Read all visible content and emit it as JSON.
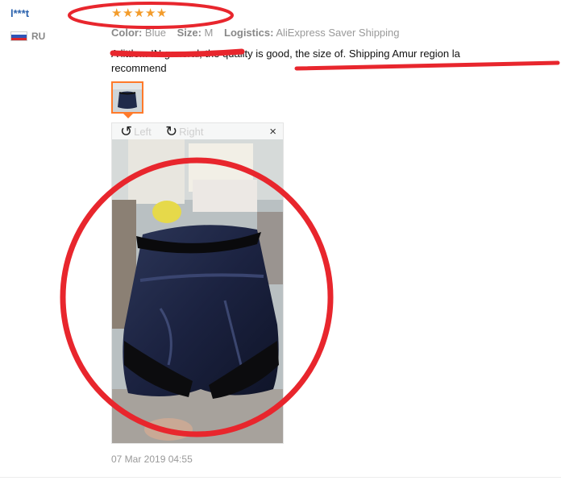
{
  "review": {
    "username": "l***t",
    "country": "RU",
    "rating": 5,
    "stars": "★★★★★",
    "attributes": [
      {
        "label": "Color:",
        "value": "Blue"
      },
      {
        "label": "Size:",
        "value": "M"
      },
      {
        "label": "Logistics:",
        "value": "AliExpress Saver Shipping"
      }
    ],
    "text_line1": "A little... IN general, the quality is good, the size of. Shipping Amur region la",
    "text_line2": "recommend",
    "viewer": {
      "rotate_left_label": "Left",
      "rotate_right_label": "Right",
      "close_symbol": "×"
    },
    "date": "07 Mar 2019 04:55"
  },
  "colors": {
    "username": "#2b62ad",
    "star": "#f39c2b",
    "thumb_border": "#ff7a2a",
    "annotation": "#e8262d"
  },
  "icons": [
    "flag-ru-icon",
    "rotate-left-icon",
    "rotate-right-icon",
    "close-icon"
  ]
}
